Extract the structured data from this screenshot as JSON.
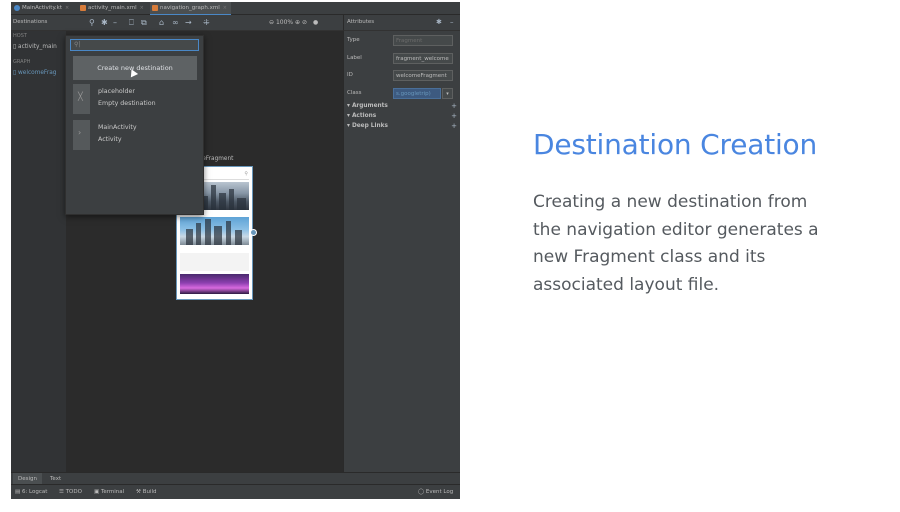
{
  "editor_tabs": [
    {
      "label": "MainActivity.kt",
      "icon": "kotlin-file-icon",
      "color": "#4a88c7"
    },
    {
      "label": "activity_main.xml",
      "icon": "layout-file-icon",
      "color": "#d87c3a"
    },
    {
      "label": "navigation_graph.xml",
      "icon": "navigation-file-icon",
      "color": "#d87c3a",
      "active": true
    }
  ],
  "toolbar": {
    "destinations_label": "Destinations",
    "zoom_level": "100%"
  },
  "attributes_header": {
    "label": "Attributes"
  },
  "destinations_panel": {
    "host_section": "HOST",
    "host_item": "activity_main",
    "graph_section": "GRAPH",
    "graph_item": "welcomeFrag"
  },
  "new_destination_popup": {
    "search_value": "",
    "create_button_label": "Create new destination",
    "options": [
      {
        "title": "placeholder",
        "subtitle": "Empty destination"
      },
      {
        "title": "MainActivity",
        "subtitle": "Activity"
      }
    ]
  },
  "canvas": {
    "fragment_label": "omeFragment"
  },
  "attributes": {
    "type_label": "Type",
    "type_placeholder": "Fragment",
    "label_label": "Label",
    "label_value": "fragment_welcome",
    "id_label": "ID",
    "id_value": "welcomeFragment",
    "class_label": "Class",
    "class_value": "s.googletrip)",
    "sections": [
      "Arguments",
      "Actions",
      "Deep Links"
    ]
  },
  "bottom_tabs": {
    "design": "Design",
    "text": "Text"
  },
  "status_bar": {
    "logcat": "6: Logcat",
    "todo": "TODO",
    "terminal": "Terminal",
    "build": "Build",
    "event_log": "Event Log"
  },
  "slide": {
    "title": "Destination Creation",
    "body_lines": [
      "Creating a new destination from",
      "the navigation editor generates a",
      "new Fragment class and its",
      "associated layout file."
    ]
  },
  "colors": {
    "accent": "#4a86e0",
    "ide_background": "#2b2b2b",
    "selection_blue": "#6897bb"
  }
}
